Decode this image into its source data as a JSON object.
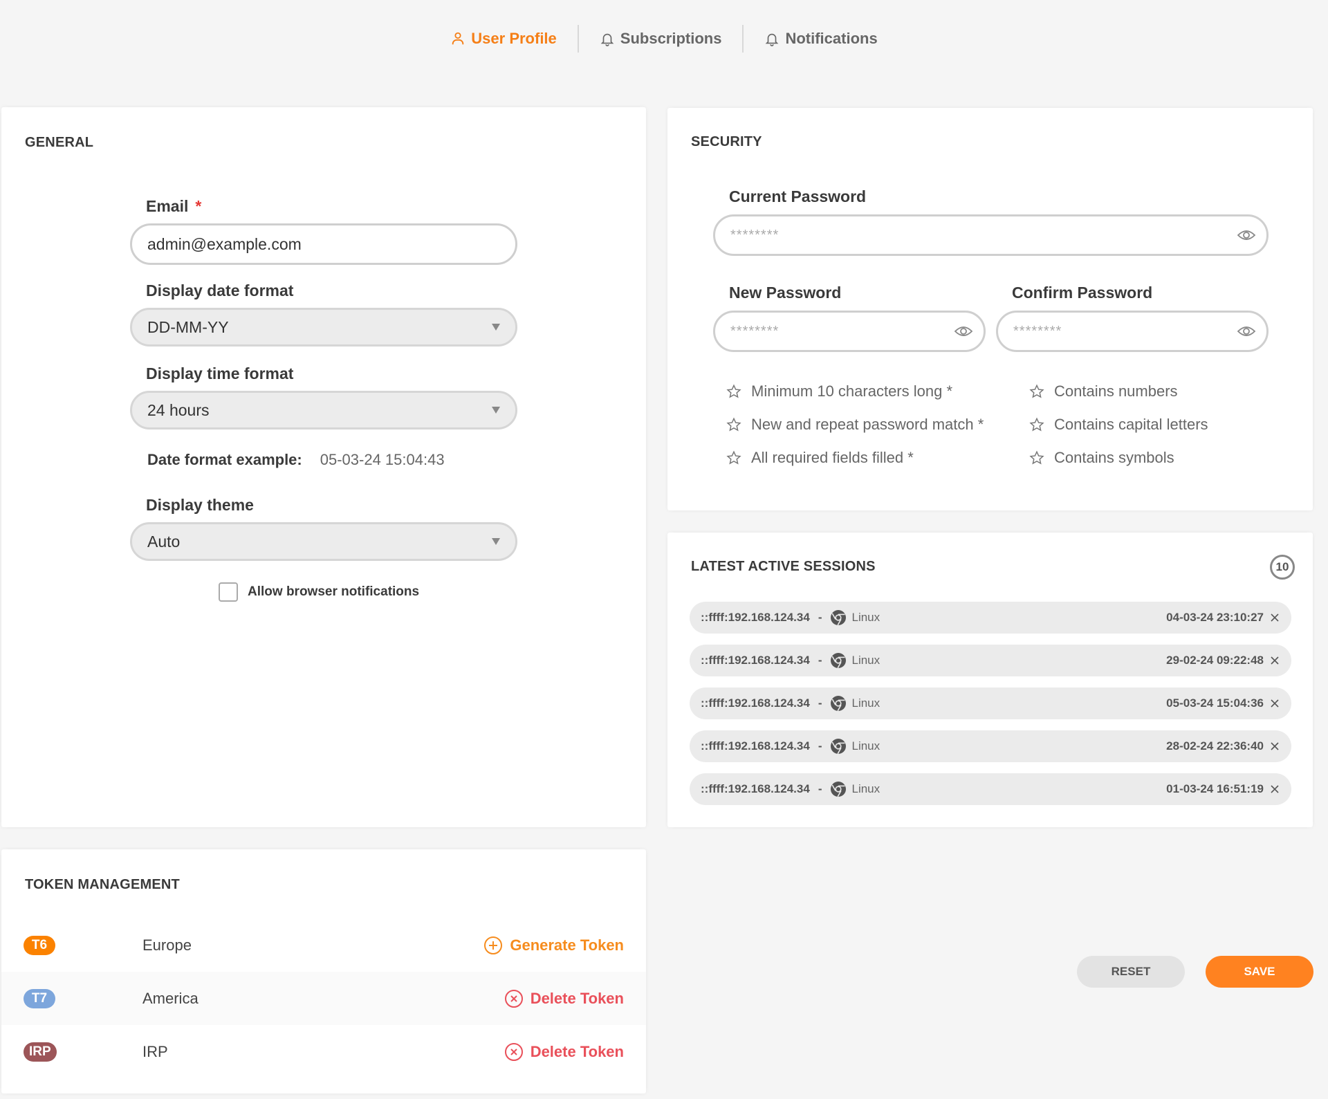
{
  "tabs": [
    {
      "label": "User Profile",
      "icon": "user-icon",
      "active": true
    },
    {
      "label": "Subscriptions",
      "icon": "bell-icon",
      "active": false
    },
    {
      "label": "Notifications",
      "icon": "bell-icon",
      "active": false
    }
  ],
  "general": {
    "title": "GENERAL",
    "email": {
      "label": "Email",
      "required_mark": "*",
      "value": "admin@example.com"
    },
    "date_format": {
      "label": "Display date format",
      "value": "DD-MM-YY"
    },
    "time_format": {
      "label": "Display time format",
      "value": "24 hours"
    },
    "example": {
      "label": "Date format example:",
      "value": "05-03-24 15:04:43"
    },
    "theme": {
      "label": "Display theme",
      "value": "Auto"
    },
    "notifications_checkbox": {
      "label": "Allow browser notifications",
      "checked": false
    }
  },
  "security": {
    "title": "SECURITY",
    "current_password": {
      "label": "Current Password",
      "placeholder": "********"
    },
    "new_password": {
      "label": "New Password",
      "placeholder": "********"
    },
    "confirm_password": {
      "label": "Confirm Password",
      "placeholder": "********"
    },
    "rules": [
      "Minimum 10 characters long *",
      "Contains numbers",
      "New and repeat password match *",
      "Contains capital letters",
      "All required fields filled *",
      "Contains symbols"
    ]
  },
  "sessions": {
    "title": "LATEST ACTIVE SESSIONS",
    "count": "10",
    "items": [
      {
        "ip": "::ffff:192.168.124.34",
        "separator": "-",
        "browser": "chrome-icon",
        "os": "Linux",
        "time": "04-03-24 23:10:27"
      },
      {
        "ip": "::ffff:192.168.124.34",
        "separator": "-",
        "browser": "chrome-icon",
        "os": "Linux",
        "time": "29-02-24 09:22:48"
      },
      {
        "ip": "::ffff:192.168.124.34",
        "separator": "-",
        "browser": "chrome-icon",
        "os": "Linux",
        "time": "05-03-24 15:04:36"
      },
      {
        "ip": "::ffff:192.168.124.34",
        "separator": "-",
        "browser": "chrome-icon",
        "os": "Linux",
        "time": "28-02-24 22:36:40"
      },
      {
        "ip": "::ffff:192.168.124.34",
        "separator": "-",
        "browser": "chrome-icon",
        "os": "Linux",
        "time": "01-03-24 16:51:19"
      }
    ]
  },
  "tokens": {
    "title": "TOKEN MANAGEMENT",
    "items": [
      {
        "badge": "T6",
        "badge_color": "#fb8200",
        "name": "Europe",
        "action": "Generate Token",
        "action_color": "#f68c1e"
      },
      {
        "badge": "T7",
        "badge_color": "#7da6dc",
        "name": "America",
        "action": "Delete Token",
        "action_color": "#e9505a"
      },
      {
        "badge": "IRP",
        "badge_color": "#9c5558",
        "name": "IRP",
        "action": "Delete Token",
        "action_color": "#e9505a"
      }
    ]
  },
  "buttons": {
    "reset": "RESET",
    "save": "SAVE"
  },
  "colors": {
    "accent": "#f57f17",
    "save": "#ff8220",
    "danger": "#e9505a"
  }
}
